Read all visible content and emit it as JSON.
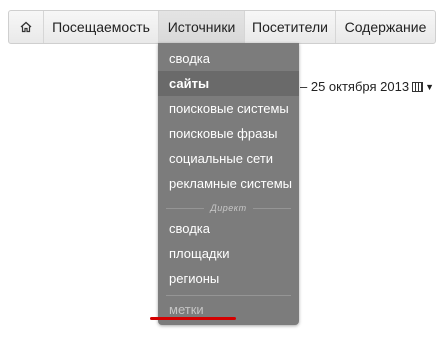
{
  "nav": {
    "home_icon": "home-icon",
    "items": [
      {
        "label": "Посещаемость"
      },
      {
        "label": "Источники",
        "active": true
      },
      {
        "label": "Посетители"
      },
      {
        "label": "Содержание"
      }
    ]
  },
  "datebar": {
    "text": "– 25 октября 2013",
    "calendar_icon": "calendar-icon",
    "caret_icon": "caret-down-icon"
  },
  "menu": {
    "items": [
      {
        "label": "сводка"
      },
      {
        "label": "сайты",
        "active": true
      },
      {
        "label": "поисковые системы"
      },
      {
        "label": "поисковые фразы"
      },
      {
        "label": "социальные сети"
      },
      {
        "label": "рекламные системы"
      }
    ],
    "section_heading": "Директ",
    "direct_items": [
      {
        "label": "сводка"
      },
      {
        "label": "площадки"
      },
      {
        "label": "регионы"
      }
    ],
    "footer_item": {
      "label": "метки"
    }
  },
  "colors": {
    "menu_bg": "#7c7c7c",
    "menu_active_bg": "#6a6a6a",
    "highlight_underline": "#d40000"
  }
}
